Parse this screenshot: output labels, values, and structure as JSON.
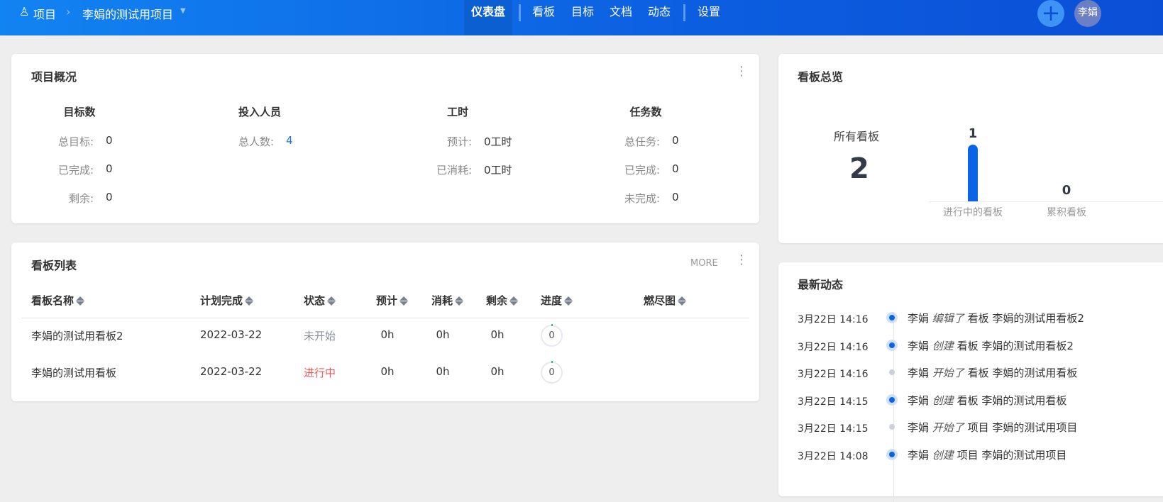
{
  "header": {
    "project_label": "项目",
    "project_name": "李娟的测试用项目",
    "nav": [
      "仪表盘",
      "看板",
      "目标",
      "文档",
      "动态",
      "设置"
    ],
    "active_tab": "仪表盘",
    "avatar": "李娟"
  },
  "overview": {
    "title": "项目概况",
    "groups": [
      {
        "title": "目标数",
        "rows": [
          {
            "label": "总目标:",
            "value": "0"
          },
          {
            "label": "已完成:",
            "value": "0"
          },
          {
            "label": "剩余:",
            "value": "0"
          }
        ]
      },
      {
        "title": "投入人员",
        "rows": [
          {
            "label": "总人数:",
            "value": "4"
          }
        ]
      },
      {
        "title": "工时",
        "rows": [
          {
            "label": "预计:",
            "value": "0工时"
          },
          {
            "label": "已消耗:",
            "value": "0工时"
          }
        ]
      },
      {
        "title": "任务数",
        "rows": [
          {
            "label": "总任务:",
            "value": "0"
          },
          {
            "label": "已完成:",
            "value": "0"
          },
          {
            "label": "未完成:",
            "value": "0"
          }
        ]
      }
    ]
  },
  "board_list": {
    "title": "看板列表",
    "more": "MORE",
    "columns": [
      "看板名称",
      "计划完成",
      "状态",
      "预计",
      "消耗",
      "剩余",
      "进度",
      "燃尽图"
    ],
    "rows": [
      {
        "name": "李娟的测试用看板2",
        "date": "2022-03-22",
        "status": "未开始",
        "est": "0h",
        "used": "0h",
        "left": "0h",
        "progress": "0"
      },
      {
        "name": "李娟的测试用看板",
        "date": "2022-03-22",
        "status": "进行中",
        "est": "0h",
        "used": "0h",
        "left": "0h",
        "progress": "0"
      }
    ]
  },
  "board_summary": {
    "title": "看板总览",
    "all_label": "所有看板",
    "all_count": "2",
    "chart_data": {
      "type": "bar",
      "categories": [
        "进行中的看板",
        "累积看板"
      ],
      "values": [
        1,
        0
      ],
      "value_labels": [
        "1",
        "0"
      ]
    }
  },
  "activity": {
    "title": "最新动态",
    "items": [
      {
        "time": "3月22日 14:16",
        "user": "李娟",
        "action": "编辑了",
        "type": "看板",
        "target": "李娟的测试用看板2",
        "major": true
      },
      {
        "time": "3月22日 14:16",
        "user": "李娟",
        "action": "创建",
        "type": "看板",
        "target": "李娟的测试用看板2",
        "major": true
      },
      {
        "time": "3月22日 14:16",
        "user": "李娟",
        "action": "开始了",
        "type": "看板",
        "target": "李娟的测试用看板",
        "major": false
      },
      {
        "time": "3月22日 14:15",
        "user": "李娟",
        "action": "创建",
        "type": "看板",
        "target": "李娟的测试用看板",
        "major": true
      },
      {
        "time": "3月22日 14:15",
        "user": "李娟",
        "action": "开始了",
        "type": "项目",
        "target": "李娟的测试用项目",
        "major": false
      },
      {
        "time": "3月22日 14:08",
        "user": "李娟",
        "action": "创建",
        "type": "项目",
        "target": "李娟的测试用项目",
        "major": true
      }
    ]
  },
  "colors": {
    "primary": "#0b63e5",
    "status_not_started": "#8a8f99",
    "status_in_progress": "#f25a5a",
    "link": "#1e6fe0"
  }
}
